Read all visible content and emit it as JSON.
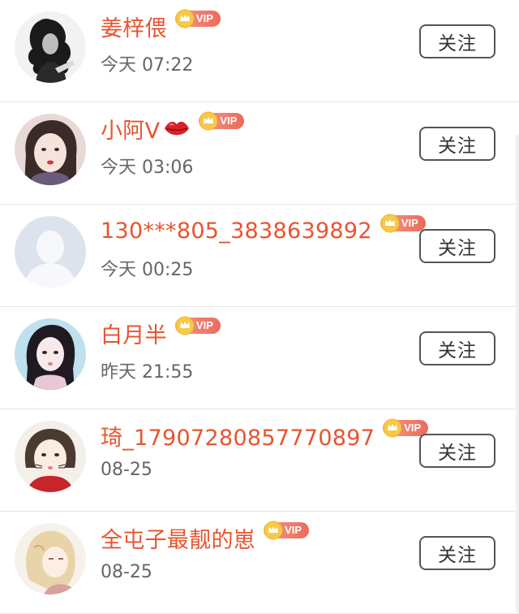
{
  "follow_label": "关注",
  "vip_label": "VIP",
  "users": [
    {
      "name": "姜梓偎",
      "time": "今天 07:22",
      "vip": true,
      "emoji": ""
    },
    {
      "name": "小阿V",
      "time": "今天 03:06",
      "vip": true,
      "emoji": "lips"
    },
    {
      "name": "130***805_3838639892",
      "time": "今天 00:25",
      "vip": true,
      "emoji": ""
    },
    {
      "name": "白月半",
      "time": "昨天 21:55",
      "vip": true,
      "emoji": ""
    },
    {
      "name": "琦_17907280857770897",
      "time": "08-25",
      "vip": true,
      "emoji": ""
    },
    {
      "name": "全屯子最靓的崽",
      "time": "08-25",
      "vip": true,
      "emoji": ""
    }
  ],
  "colors": {
    "name": "#e8542f",
    "time": "#666666",
    "vip_badge": "#ec6a5a",
    "button_border": "#555555"
  }
}
